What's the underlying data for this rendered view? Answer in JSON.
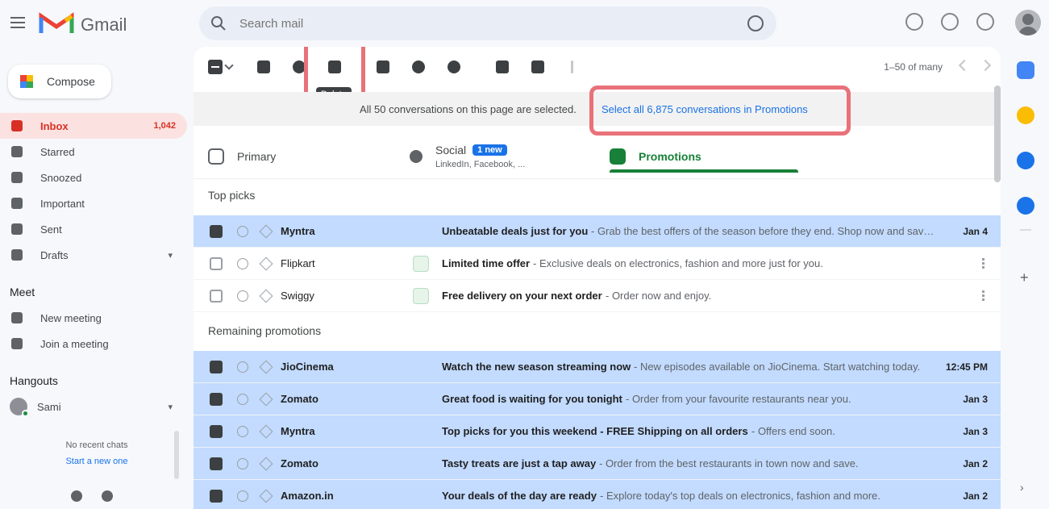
{
  "app": {
    "name": "Gmail"
  },
  "search": {
    "placeholder": "Search mail"
  },
  "compose": {
    "label": "Compose"
  },
  "sidebar": {
    "items": [
      {
        "label": "Inbox",
        "count": "1,042",
        "active": true
      },
      {
        "label": "Starred"
      },
      {
        "label": "Snoozed"
      },
      {
        "label": "Important"
      },
      {
        "label": "Sent"
      },
      {
        "label": "Drafts"
      }
    ],
    "meet": {
      "heading": "Meet",
      "items": [
        "New meeting",
        "Join a meeting"
      ]
    },
    "hangouts": {
      "heading": "Hangouts",
      "user": "Sami",
      "no_chats": "No recent chats",
      "start_new": "Start a new one"
    }
  },
  "toolbar": {
    "tooltip": "Delete",
    "pager": "1–50 of many"
  },
  "banner": {
    "text": "All 50 conversations on this page are selected.",
    "link": "Select all 6,875 conversations in Promotions"
  },
  "tabs": {
    "primary": "Primary",
    "social": "Social",
    "social_badge": "1 new",
    "social_sub": "LinkedIn, Facebook, ...",
    "promotions": "Promotions"
  },
  "sections": {
    "top": "Top picks",
    "remaining": "Remaining promotions"
  },
  "top_rows": [
    {
      "sender": "Myntra",
      "subject": "Unbeatable deals just for you",
      "snippet": " - Grab the best offers of the season before they end. Shop now and save big on top brands.",
      "date": "Jan 4",
      "selected": true,
      "ad": false
    },
    {
      "sender": "Flipkart",
      "subject": "Limited time offer",
      "snippet": " - Exclusive deals on electronics, fashion and more just for you.",
      "date": "",
      "selected": false,
      "ad": true
    },
    {
      "sender": "Swiggy",
      "subject": "Free delivery on your next order",
      "snippet": " - Order now and enjoy.",
      "date": "",
      "selected": false,
      "ad": true
    }
  ],
  "remaining_rows": [
    {
      "sender": "JioCinema",
      "subject": "Watch the new season streaming now",
      "snippet": " - New episodes available on JioCinema. Start watching today.",
      "date": "12:45 PM"
    },
    {
      "sender": "Zomato",
      "subject": "Great food is waiting for you tonight",
      "snippet": " - Order from your favourite restaurants near you.",
      "date": "Jan 3"
    },
    {
      "sender": "Myntra",
      "subject": "Top picks for you this weekend - FREE Shipping on all orders",
      "snippet": " - Offers end soon.",
      "date": "Jan 3"
    },
    {
      "sender": "Zomato",
      "subject": "Tasty treats are just a tap away",
      "snippet": " - Order from the best restaurants in town now and save.",
      "date": "Jan 2"
    },
    {
      "sender": "Amazon.in",
      "subject": "Your deals of the day are ready",
      "snippet": " - Explore today's top deals on electronics, fashion and more.",
      "date": "Jan 2"
    }
  ],
  "colors": {
    "accent_red": "#d93025",
    "promo_green": "#188038",
    "selected_row": "#c2dbff",
    "link_blue": "#1a73e8",
    "highlight_box": "#e8717a"
  }
}
